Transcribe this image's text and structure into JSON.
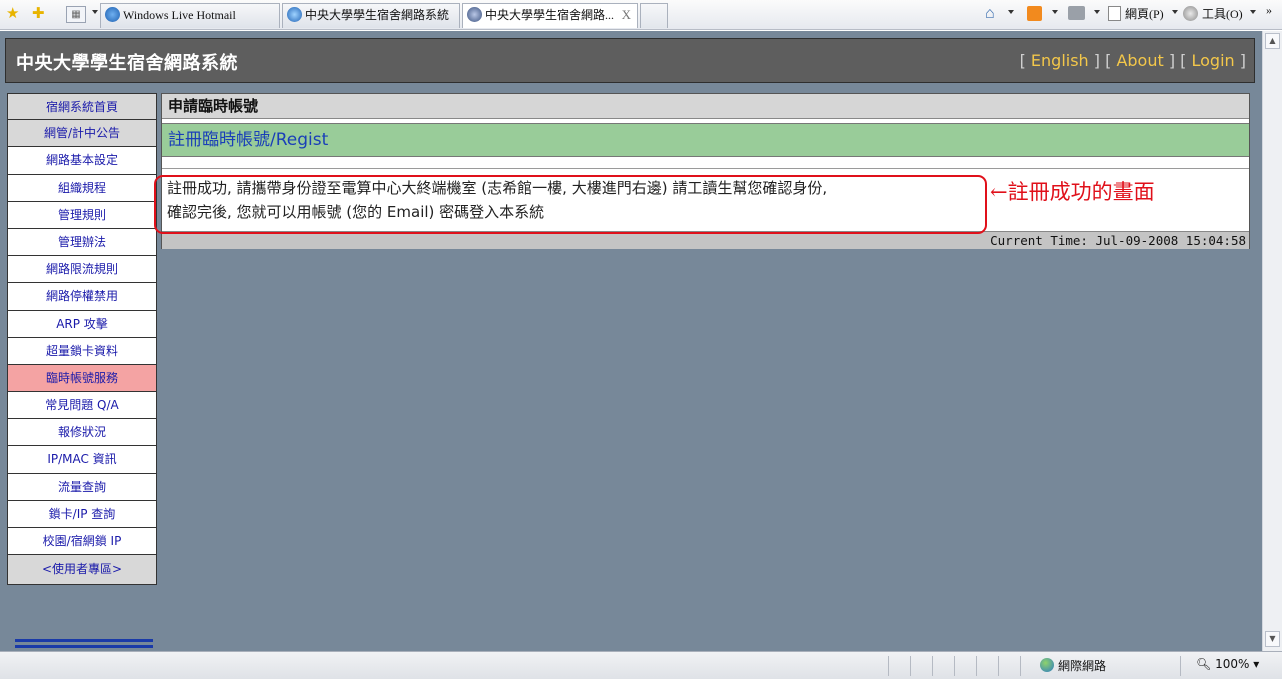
{
  "browser": {
    "tabs": [
      {
        "label": "Windows Live Hotmail"
      },
      {
        "label": "中央大學學生宿舍網路系統"
      },
      {
        "label": "中央大學學生宿舍網路..."
      }
    ],
    "tab_close": "X",
    "home": "⌂",
    "menu_page": "網頁(P)",
    "menu_tools": "工具(O)",
    "more": "»",
    "status_zone": "網際網路",
    "status_zoom": "100%"
  },
  "header": {
    "title": "中央大學學生宿舍網路系統",
    "links": [
      "English",
      "About",
      "Login"
    ]
  },
  "sidebar": {
    "items": [
      {
        "label": "宿網系統首頁"
      },
      {
        "label": "網管/計中公告"
      },
      {
        "label": "網路基本設定"
      },
      {
        "label": "組織規程"
      },
      {
        "label": "管理規則"
      },
      {
        "label": "管理辦法"
      },
      {
        "label": "網路限流規則"
      },
      {
        "label": "網路停權禁用"
      },
      {
        "label": "ARP 攻擊"
      },
      {
        "label": "超量鎖卡資料"
      },
      {
        "label": "臨時帳號服務"
      },
      {
        "label": "常見問題 Q/A"
      },
      {
        "label": "報修狀況"
      },
      {
        "label": "IP/MAC 資訊"
      },
      {
        "label": "流量查詢"
      },
      {
        "label": "鎖卡/IP 查詢"
      },
      {
        "label": "校園/宿網鎖 IP"
      }
    ],
    "user_area": "<使用者專區>"
  },
  "main": {
    "title": "申請臨時帳號",
    "register_link": "註冊臨時帳號/Regist",
    "message_line1": "註冊成功, 請攜帶身份證至電算中心大終端機室 (志希館一樓, 大樓進門右邊) 請工讀生幫您確認身份,",
    "message_line2": "確認完後, 您就可以用帳號 (您的 Email) 密碼登入本系統",
    "current_time": "Current Time: Jul-09-2008 15:04:58"
  },
  "annotation": "←註冊成功的畫面",
  "colors": {
    "page_bg": "#778899",
    "header_bg": "#5e5e5e",
    "link_yellow": "#f3c74a",
    "green_bar": "#99cc99",
    "active_nav": "#f4a3a3",
    "annotation_red": "#e0101a"
  }
}
